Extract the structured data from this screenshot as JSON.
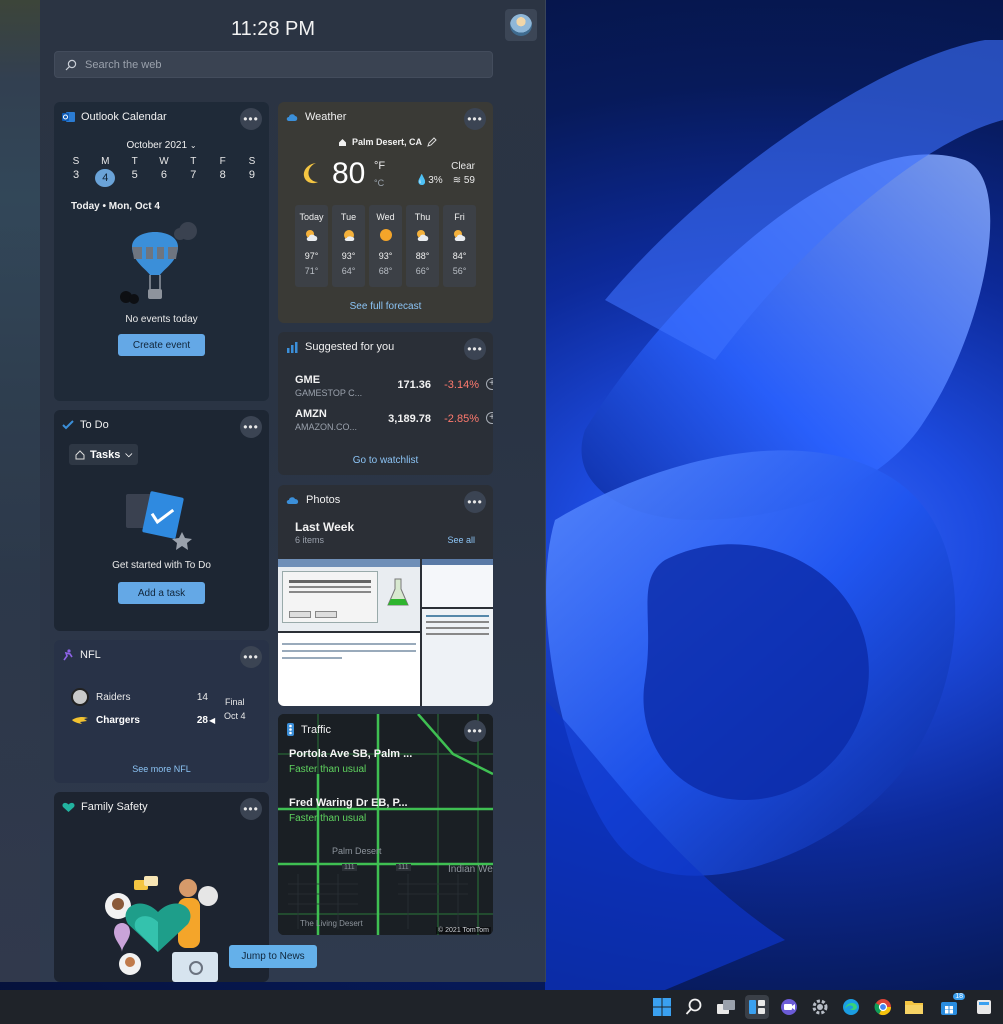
{
  "clock": "11:28 PM",
  "search": {
    "placeholder": "Search the web"
  },
  "calendar": {
    "title": "Outlook Calendar",
    "month": "October 2021",
    "weekdays": [
      "S",
      "M",
      "T",
      "W",
      "T",
      "F",
      "S"
    ],
    "days": [
      "3",
      "4",
      "5",
      "6",
      "7",
      "8",
      "9"
    ],
    "today_label": "Today • Mon, Oct 4",
    "empty_text": "No events today",
    "create_label": "Create event"
  },
  "weather": {
    "title": "Weather",
    "location": "Palm Desert, CA",
    "temp": "80",
    "unit_f": "°F",
    "unit_c": "°C",
    "condition": "Clear",
    "precip": "3%",
    "aqi": "59",
    "forecast": [
      {
        "day": "Today",
        "hi": "97°",
        "lo": "71°",
        "icon": "partly-cloudy-icon"
      },
      {
        "day": "Tue",
        "hi": "93°",
        "lo": "64°",
        "icon": "partly-sunny-icon"
      },
      {
        "day": "Wed",
        "hi": "93°",
        "lo": "68°",
        "icon": "sunny-icon"
      },
      {
        "day": "Thu",
        "hi": "88°",
        "lo": "66°",
        "icon": "partly-cloudy-icon"
      },
      {
        "day": "Fri",
        "hi": "84°",
        "lo": "56°",
        "icon": "partly-cloudy-icon"
      }
    ],
    "full_forecast_label": "See full forecast"
  },
  "stocks": {
    "title": "Suggested for you",
    "items": [
      {
        "symbol": "GME",
        "name": "GAMESTOP C...",
        "price": "171.36",
        "change": "-3.14%"
      },
      {
        "symbol": "AMZN",
        "name": "AMAZON.CO...",
        "price": "3,189.78",
        "change": "-2.85%"
      }
    ],
    "watchlist_label": "Go to watchlist"
  },
  "todo": {
    "title": "To Do",
    "list_label": "Tasks",
    "prompt": "Get started with To Do",
    "add_label": "Add a task"
  },
  "photos": {
    "title": "Photos",
    "album": "Last Week",
    "count": "6 items",
    "see_all": "See all"
  },
  "nfl": {
    "title": "NFL",
    "team1": "Raiders",
    "score1": "14",
    "team2": "Chargers",
    "score2": "28",
    "status": "Final",
    "date": "Oct 4",
    "more_label": "See more NFL"
  },
  "traffic": {
    "title": "Traffic",
    "routes": [
      {
        "name": "Portola Ave SB, Palm ...",
        "status": "Faster than usual"
      },
      {
        "name": "Fred Waring Dr EB, P...",
        "status": "Faster than usual"
      }
    ],
    "map_labels": [
      "Palm Desert",
      "Indian We",
      "The Living Desert",
      "111",
      "111"
    ],
    "attribution": "© 2021 TomTom"
  },
  "family": {
    "title": "Family Safety"
  },
  "jump_label": "Jump to News",
  "more_glyph": "•••",
  "colors": {
    "accent": "#64a8e6",
    "negative": "#ff7a6e",
    "positive": "#5fd35f",
    "wallpaper": "#1d4be0"
  },
  "taskbar": {
    "icons": [
      "windows-start-icon",
      "search-icon",
      "task-view-icon",
      "widgets-icon",
      "teams-chat-icon",
      "settings-icon",
      "edge-icon",
      "chrome-icon",
      "file-explorer-icon",
      "store-icon"
    ],
    "store_badge": "18"
  }
}
